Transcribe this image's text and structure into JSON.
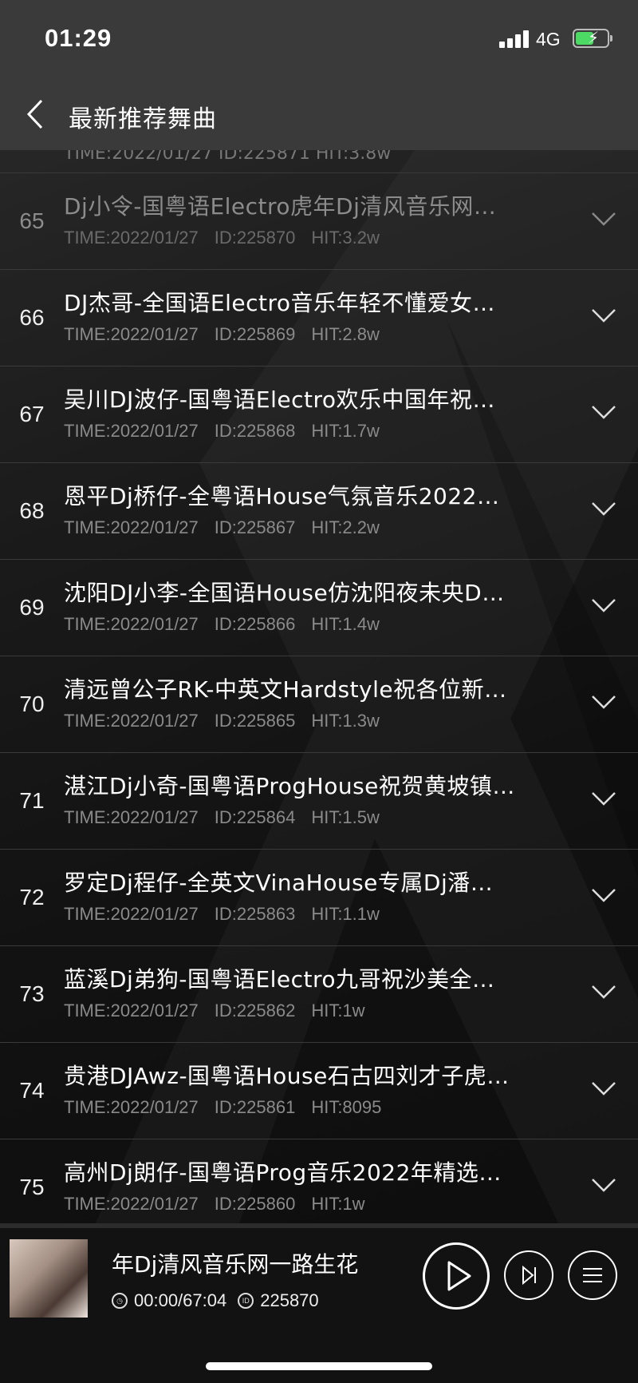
{
  "status_bar": {
    "time": "01:29",
    "network": "4G"
  },
  "nav": {
    "title": "最新推荐舞曲"
  },
  "partial_row_meta": "TIME:2022/01/27   ID:225871   HIT:3.8w",
  "rows": [
    {
      "num": "65",
      "title": "Dj小令-国粤语Electro虎年Dj清风音乐网…",
      "time": "TIME:2022/01/27",
      "id": "ID:225870",
      "hit": "HIT:3.2w"
    },
    {
      "num": "66",
      "title": "DJ杰哥-全国语Electro音乐年轻不懂爱女…",
      "time": "TIME:2022/01/27",
      "id": "ID:225869",
      "hit": "HIT:2.8w"
    },
    {
      "num": "67",
      "title": "吴川DJ波仔-国粤语Electro欢乐中国年祝…",
      "time": "TIME:2022/01/27",
      "id": "ID:225868",
      "hit": "HIT:1.7w"
    },
    {
      "num": "68",
      "title": "恩平Dj桥仔-全粤语House气氛音乐2022…",
      "time": "TIME:2022/01/27",
      "id": "ID:225867",
      "hit": "HIT:2.2w"
    },
    {
      "num": "69",
      "title": "沈阳DJ小李-全国语House仿沈阳夜未央D…",
      "time": "TIME:2022/01/27",
      "id": "ID:225866",
      "hit": "HIT:1.4w"
    },
    {
      "num": "70",
      "title": "清远曾公子RK-中英文Hardstyle祝各位新…",
      "time": "TIME:2022/01/27",
      "id": "ID:225865",
      "hit": "HIT:1.3w"
    },
    {
      "num": "71",
      "title": "湛江Dj小奇-国粤语ProgHouse祝贺黄坡镇…",
      "time": "TIME:2022/01/27",
      "id": "ID:225864",
      "hit": "HIT:1.5w"
    },
    {
      "num": "72",
      "title": "罗定Dj程仔-全英文VinaHouse专属Dj潘…",
      "time": "TIME:2022/01/27",
      "id": "ID:225863",
      "hit": "HIT:1.1w"
    },
    {
      "num": "73",
      "title": "蓝溪Dj弟狗-国粤语Electro九哥祝沙美全…",
      "time": "TIME:2022/01/27",
      "id": "ID:225862",
      "hit": "HIT:1w"
    },
    {
      "num": "74",
      "title": "贵港DJAwz-国粤语House石古四刘才子虎…",
      "time": "TIME:2022/01/27",
      "id": "ID:225861",
      "hit": "HIT:8095"
    },
    {
      "num": "75",
      "title": "高州Dj朗仔-国粤语Prog音乐2022年精选…",
      "time": "TIME:2022/01/27",
      "id": "ID:225860",
      "hit": "HIT:1w"
    }
  ],
  "player": {
    "title": "年Dj清风音乐网一路生花",
    "duration": "00:00/67:04",
    "id_badge": "ID",
    "id": "225870"
  },
  "icons": [
    "back-chevron-icon",
    "expand-chevron-icon",
    "play-icon",
    "next-track-icon",
    "playlist-icon",
    "clock-icon",
    "id-icon"
  ]
}
